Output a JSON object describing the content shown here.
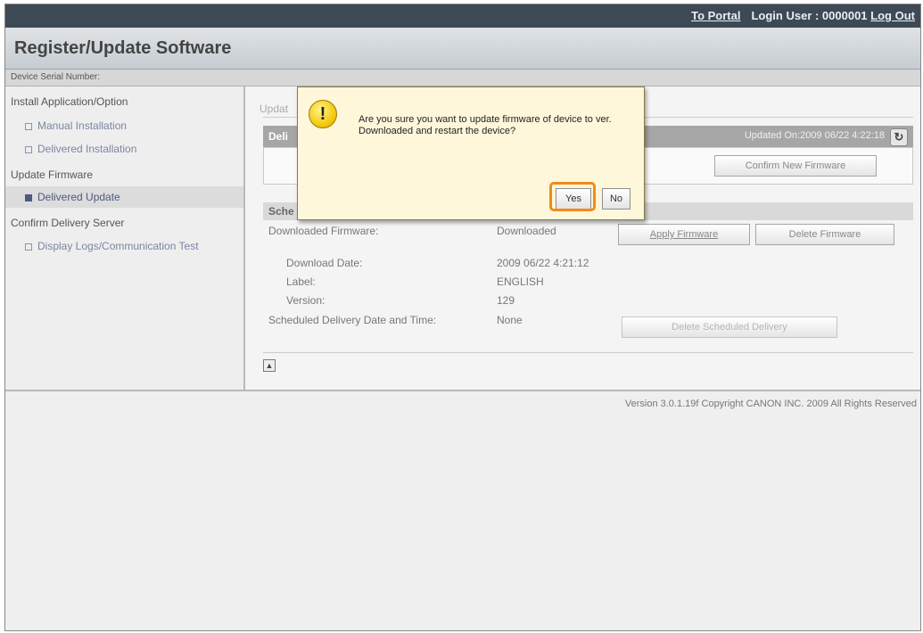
{
  "topbar": {
    "portal_link": "To Portal",
    "login_user": "Login User : 0000001",
    "logout_link": "Log Out"
  },
  "page_title": "Register/Update Software",
  "serial_label": "Device Serial Number:",
  "sidebar": {
    "install_heading": "Install Application/Option",
    "manual_installation": "Manual Installation",
    "delivered_installation": "Delivered Installation",
    "update_heading": "Update Firmware",
    "delivered_update": "Delivered Update",
    "confirm_heading": "Confirm Delivery Server",
    "display_logs": "Display Logs/Communication Test"
  },
  "main": {
    "section_label": "Updat",
    "delivery_panel_title": "Deli",
    "updated_on": "Updated On:2009 06/22 4:22:18",
    "confirm_new_firmware": "Confirm New Firmware",
    "schedule_head": "Sche",
    "rows": {
      "downloaded_firmware_label": "Downloaded Firmware:",
      "downloaded_firmware_value": "Downloaded",
      "download_date_label": "Download Date:",
      "download_date_value": "2009 06/22 4:21:12",
      "label_label": "Label:",
      "label_value": "ENGLISH",
      "version_label": "Version:",
      "version_value": "129",
      "scheduled_label": "Scheduled Delivery Date and Time:",
      "scheduled_value": "None"
    },
    "apply_firmware": "Apply Firmware",
    "delete_firmware": "Delete Firmware",
    "delete_scheduled_delivery": "Delete Scheduled Delivery"
  },
  "footer": "Version 3.0.1.19f Copyright CANON INC. 2009 All Rights Reserved",
  "dialog": {
    "icon": "warning-icon",
    "message": "Are you sure you want to update firmware of device to ver. Downloaded and restart the device?",
    "yes": "Yes",
    "no": "No",
    "highlight_color": "#f28a1e"
  }
}
